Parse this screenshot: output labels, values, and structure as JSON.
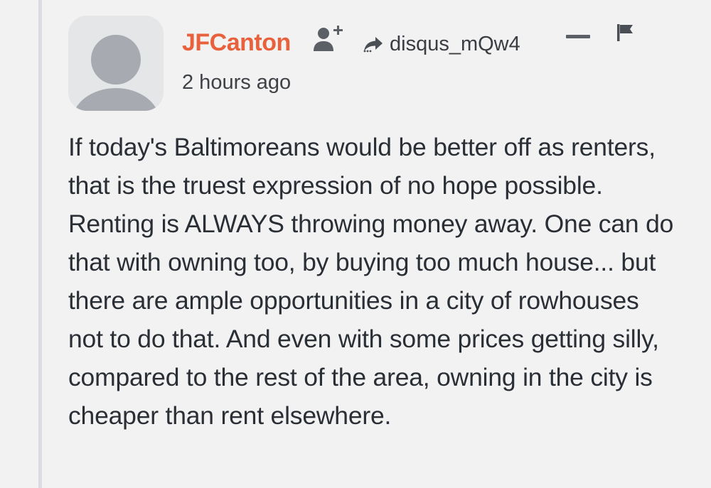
{
  "comment": {
    "author": "JFCanton",
    "reply_to_user": "disqus_mQw4",
    "timestamp": "2 hours ago",
    "body": "If today's Baltimoreans would be better off as renters, that is the truest expression of no hope possible. Renting is ALWAYS throwing money away. One can do that with owning too, by buying too much house... but there are ample opportunities in a city of rowhouses not to do that. And even with some prices getting silly, compared to the rest of the area, owning in the city is cheaper than rent elsewhere."
  },
  "icons": {
    "avatar": "default-avatar-placeholder",
    "follow": "follow-user-icon",
    "reply": "reply-arrow-icon",
    "collapse": "collapse-minus-icon",
    "flag": "flag-icon"
  },
  "colors": {
    "background": "#f2f2f3",
    "author": "#e8603c",
    "text": "#2a2e35",
    "avatar_bg": "#e4e6e8",
    "avatar_fg": "#a7abb1"
  }
}
